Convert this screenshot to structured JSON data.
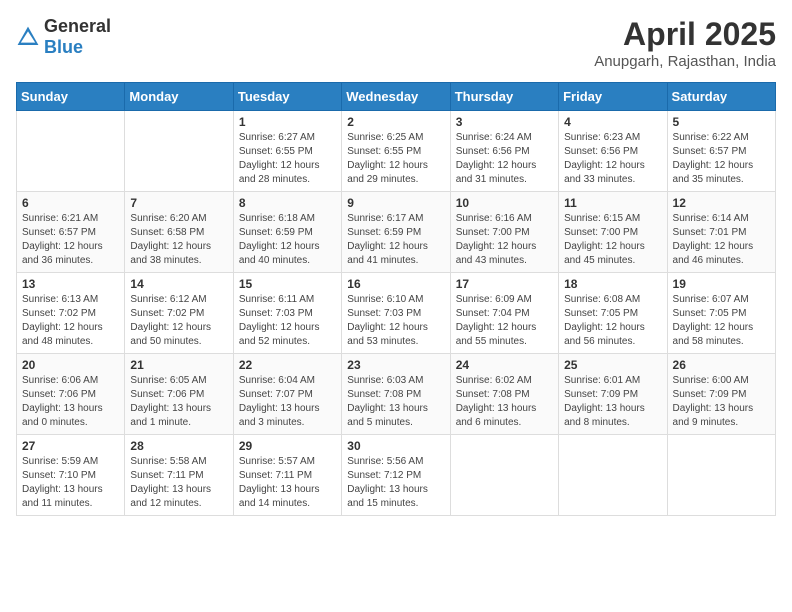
{
  "header": {
    "logo": {
      "text_general": "General",
      "text_blue": "Blue"
    },
    "month_year": "April 2025",
    "location": "Anupgarh, Rajasthan, India"
  },
  "weekdays": [
    "Sunday",
    "Monday",
    "Tuesday",
    "Wednesday",
    "Thursday",
    "Friday",
    "Saturday"
  ],
  "weeks": [
    [
      {
        "day": "",
        "info": ""
      },
      {
        "day": "",
        "info": ""
      },
      {
        "day": "1",
        "info": "Sunrise: 6:27 AM\nSunset: 6:55 PM\nDaylight: 12 hours\nand 28 minutes."
      },
      {
        "day": "2",
        "info": "Sunrise: 6:25 AM\nSunset: 6:55 PM\nDaylight: 12 hours\nand 29 minutes."
      },
      {
        "day": "3",
        "info": "Sunrise: 6:24 AM\nSunset: 6:56 PM\nDaylight: 12 hours\nand 31 minutes."
      },
      {
        "day": "4",
        "info": "Sunrise: 6:23 AM\nSunset: 6:56 PM\nDaylight: 12 hours\nand 33 minutes."
      },
      {
        "day": "5",
        "info": "Sunrise: 6:22 AM\nSunset: 6:57 PM\nDaylight: 12 hours\nand 35 minutes."
      }
    ],
    [
      {
        "day": "6",
        "info": "Sunrise: 6:21 AM\nSunset: 6:57 PM\nDaylight: 12 hours\nand 36 minutes."
      },
      {
        "day": "7",
        "info": "Sunrise: 6:20 AM\nSunset: 6:58 PM\nDaylight: 12 hours\nand 38 minutes."
      },
      {
        "day": "8",
        "info": "Sunrise: 6:18 AM\nSunset: 6:59 PM\nDaylight: 12 hours\nand 40 minutes."
      },
      {
        "day": "9",
        "info": "Sunrise: 6:17 AM\nSunset: 6:59 PM\nDaylight: 12 hours\nand 41 minutes."
      },
      {
        "day": "10",
        "info": "Sunrise: 6:16 AM\nSunset: 7:00 PM\nDaylight: 12 hours\nand 43 minutes."
      },
      {
        "day": "11",
        "info": "Sunrise: 6:15 AM\nSunset: 7:00 PM\nDaylight: 12 hours\nand 45 minutes."
      },
      {
        "day": "12",
        "info": "Sunrise: 6:14 AM\nSunset: 7:01 PM\nDaylight: 12 hours\nand 46 minutes."
      }
    ],
    [
      {
        "day": "13",
        "info": "Sunrise: 6:13 AM\nSunset: 7:02 PM\nDaylight: 12 hours\nand 48 minutes."
      },
      {
        "day": "14",
        "info": "Sunrise: 6:12 AM\nSunset: 7:02 PM\nDaylight: 12 hours\nand 50 minutes."
      },
      {
        "day": "15",
        "info": "Sunrise: 6:11 AM\nSunset: 7:03 PM\nDaylight: 12 hours\nand 52 minutes."
      },
      {
        "day": "16",
        "info": "Sunrise: 6:10 AM\nSunset: 7:03 PM\nDaylight: 12 hours\nand 53 minutes."
      },
      {
        "day": "17",
        "info": "Sunrise: 6:09 AM\nSunset: 7:04 PM\nDaylight: 12 hours\nand 55 minutes."
      },
      {
        "day": "18",
        "info": "Sunrise: 6:08 AM\nSunset: 7:05 PM\nDaylight: 12 hours\nand 56 minutes."
      },
      {
        "day": "19",
        "info": "Sunrise: 6:07 AM\nSunset: 7:05 PM\nDaylight: 12 hours\nand 58 minutes."
      }
    ],
    [
      {
        "day": "20",
        "info": "Sunrise: 6:06 AM\nSunset: 7:06 PM\nDaylight: 13 hours\nand 0 minutes."
      },
      {
        "day": "21",
        "info": "Sunrise: 6:05 AM\nSunset: 7:06 PM\nDaylight: 13 hours\nand 1 minute."
      },
      {
        "day": "22",
        "info": "Sunrise: 6:04 AM\nSunset: 7:07 PM\nDaylight: 13 hours\nand 3 minutes."
      },
      {
        "day": "23",
        "info": "Sunrise: 6:03 AM\nSunset: 7:08 PM\nDaylight: 13 hours\nand 5 minutes."
      },
      {
        "day": "24",
        "info": "Sunrise: 6:02 AM\nSunset: 7:08 PM\nDaylight: 13 hours\nand 6 minutes."
      },
      {
        "day": "25",
        "info": "Sunrise: 6:01 AM\nSunset: 7:09 PM\nDaylight: 13 hours\nand 8 minutes."
      },
      {
        "day": "26",
        "info": "Sunrise: 6:00 AM\nSunset: 7:09 PM\nDaylight: 13 hours\nand 9 minutes."
      }
    ],
    [
      {
        "day": "27",
        "info": "Sunrise: 5:59 AM\nSunset: 7:10 PM\nDaylight: 13 hours\nand 11 minutes."
      },
      {
        "day": "28",
        "info": "Sunrise: 5:58 AM\nSunset: 7:11 PM\nDaylight: 13 hours\nand 12 minutes."
      },
      {
        "day": "29",
        "info": "Sunrise: 5:57 AM\nSunset: 7:11 PM\nDaylight: 13 hours\nand 14 minutes."
      },
      {
        "day": "30",
        "info": "Sunrise: 5:56 AM\nSunset: 7:12 PM\nDaylight: 13 hours\nand 15 minutes."
      },
      {
        "day": "",
        "info": ""
      },
      {
        "day": "",
        "info": ""
      },
      {
        "day": "",
        "info": ""
      }
    ]
  ]
}
